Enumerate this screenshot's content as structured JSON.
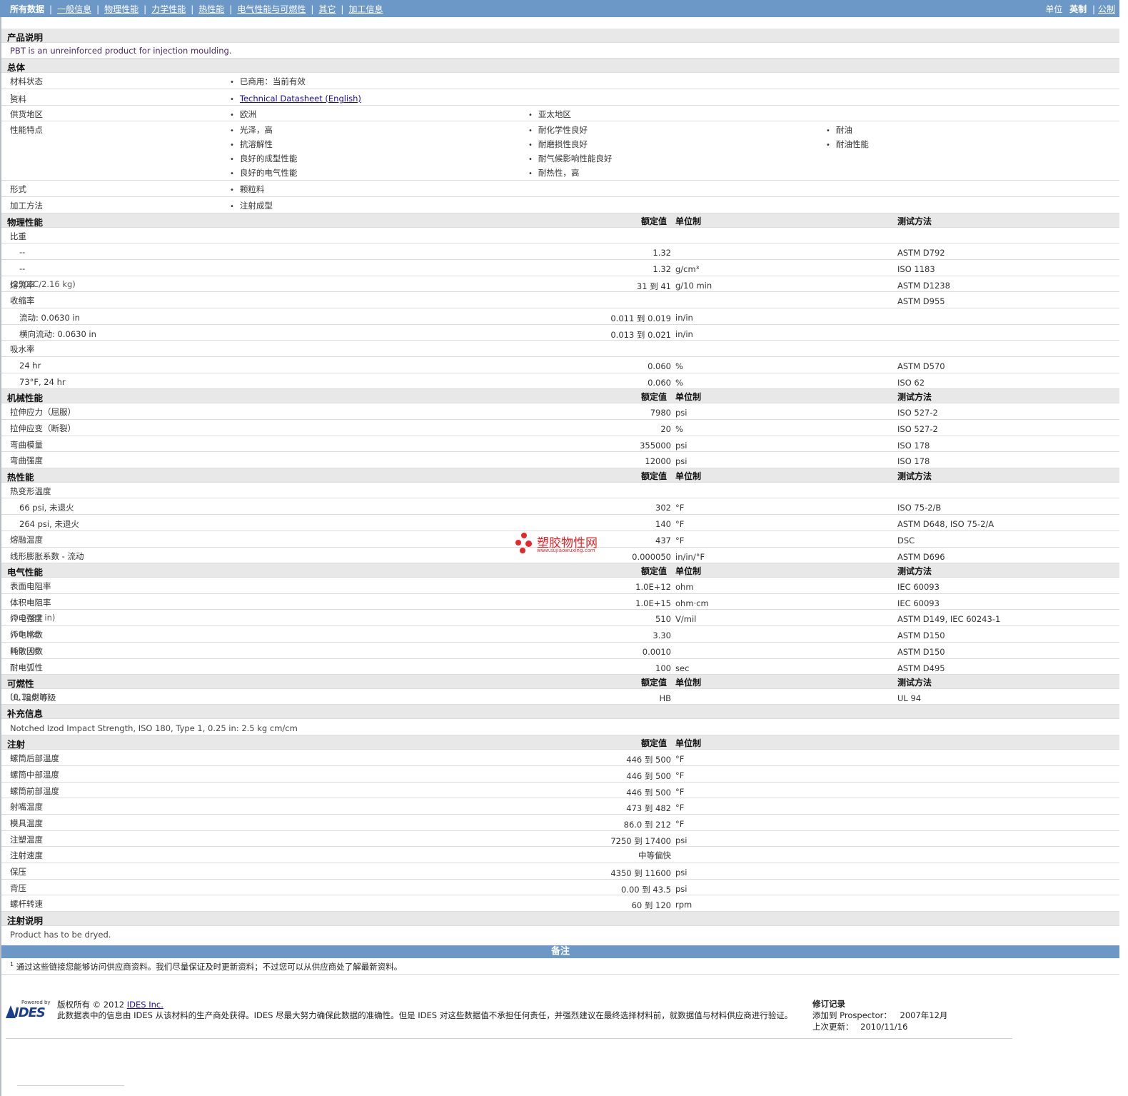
{
  "nav": {
    "items": [
      "所有数据",
      "一般信息",
      "物理性能",
      "力学性能",
      "热性能",
      "电气性能与可燃性",
      "其它",
      "加工信息"
    ],
    "units_label": "单位",
    "unit_imperial": "英制",
    "unit_metric": "公制"
  },
  "headers": {
    "value": "额定值",
    "unit": "单位制",
    "method": "测试方法"
  },
  "product": {
    "title": "产品说明",
    "text": "PBT is an unreinforced product for injection moulding."
  },
  "general": {
    "title": "总体",
    "status_label": "材料状态",
    "status_value": "已商用：当前有效",
    "docs_label": "资料",
    "docs_sup": "1",
    "docs_link": "Technical Datasheet (English)",
    "region_label": "供货地区",
    "regions": [
      "欧洲",
      "亚太地区"
    ],
    "features_label": "性能特点",
    "features_col1": [
      "光泽，高",
      "抗溶解性",
      "良好的成型性能",
      "良好的电气性能"
    ],
    "features_col2": [
      "耐化学性良好",
      "耐磨损性良好",
      "耐气候影响性能良好",
      "耐热性，高"
    ],
    "features_col3": [
      "耐油",
      "耐油性能"
    ],
    "form_label": "形式",
    "form_value": "颗粒料",
    "process_label": "加工方法",
    "process_value": "注射成型"
  },
  "physical": {
    "title": "物理性能",
    "sg_label": "比重",
    "sg1": {
      "label": "--",
      "value": "1.32",
      "unit": "",
      "method": "ASTM D792"
    },
    "sg2": {
      "label": "--",
      "value": "1.32",
      "unit": "g/cm³",
      "method": "ISO 1183"
    },
    "mfr": {
      "label": "熔流率",
      "note": "(250°C/2.16 kg)",
      "value": "31 到 41",
      "unit": "g/10 min",
      "method": "ASTM D1238"
    },
    "shrink_label": "收缩率",
    "shrink_method": "ASTM D955",
    "shrink1": {
      "label": "流动: 0.0630 in",
      "value": "0.011 到 0.019",
      "unit": "in/in"
    },
    "shrink2": {
      "label": "横向流动: 0.0630 in",
      "value": "0.013 到 0.021",
      "unit": "in/in"
    },
    "water_label": "吸水率",
    "water1": {
      "label": "24 hr",
      "value": "0.060",
      "unit": "%",
      "method": "ASTM D570"
    },
    "water2": {
      "label": "73°F, 24 hr",
      "value": "0.060",
      "unit": "%",
      "method": "ISO 62"
    }
  },
  "mechanical": {
    "title": "机械性能",
    "rows": [
      {
        "label": "拉伸应力（屈服）",
        "value": "7980",
        "unit": "psi",
        "method": "ISO 527-2"
      },
      {
        "label": "拉伸应变（断裂）",
        "value": "20",
        "unit": "%",
        "method": "ISO 527-2"
      },
      {
        "label": "弯曲模量",
        "value": "355000",
        "unit": "psi",
        "method": "ISO 178"
      },
      {
        "label": "弯曲强度",
        "value": "12000",
        "unit": "psi",
        "method": "ISO 178"
      }
    ]
  },
  "thermal": {
    "title": "热性能",
    "hdt_label": "热变形温度",
    "hdt1": {
      "label": "66 psi, 未退火",
      "value": "302",
      "unit": "°F",
      "method": "ISO 75-2/B"
    },
    "hdt2": {
      "label": "264 psi, 未退火",
      "value": "140",
      "unit": "°F",
      "method": "ASTM D648, ISO 75-2/A"
    },
    "melt": {
      "label": "熔融温度",
      "value": "437",
      "unit": "°F",
      "method": "DSC"
    },
    "clte": {
      "label": "线形膨胀系数 - 流动",
      "value": "0.000050",
      "unit": "in/in/°F",
      "method": "ASTM D696"
    }
  },
  "electrical": {
    "title": "电气性能",
    "rows": [
      {
        "label": "表面电阻率",
        "note": "",
        "value": "1.0E+12",
        "unit": "ohm",
        "method": "IEC 60093"
      },
      {
        "label": "体积电阻率",
        "note": "",
        "value": "1.0E+15",
        "unit": "ohm·cm",
        "method": "IEC 60093"
      },
      {
        "label": "介电强度",
        "note": "(0.0787 in)",
        "value": "510",
        "unit": "V/mil",
        "method": "ASTM D149, IEC 60243-1"
      },
      {
        "label": "介电常数",
        "note": "(60 Hz)",
        "value": "3.30",
        "unit": "",
        "method": "ASTM D150"
      },
      {
        "label": "耗散因数",
        "note": "(60 Hz)",
        "value": "0.0010",
        "unit": "",
        "method": "ASTM D150"
      },
      {
        "label": "耐电弧性",
        "note": "",
        "value": "100",
        "unit": "sec",
        "method": "ASTM D495"
      }
    ]
  },
  "flammability": {
    "title": "可燃性",
    "row": {
      "label": "UL 阻燃等级",
      "note": "(0.126 in)",
      "value": "HB",
      "unit": "",
      "method": "UL 94"
    }
  },
  "supplement": {
    "title": "补充信息",
    "text": "Notched Izod Impact Strength, ISO 180, Type 1, 0.25 in: 2.5 kg cm/cm"
  },
  "injection": {
    "title": "注射",
    "rows": [
      {
        "label": "螺筒后部温度",
        "value": "446 到 500",
        "unit": "°F"
      },
      {
        "label": "螺筒中部温度",
        "value": "446 到 500",
        "unit": "°F"
      },
      {
        "label": "螺筒前部温度",
        "value": "446 到 500",
        "unit": "°F"
      },
      {
        "label": "射嘴温度",
        "value": "473 到 482",
        "unit": "°F"
      },
      {
        "label": "模具温度",
        "value": "86.0 到 212",
        "unit": "°F"
      },
      {
        "label": "注塑温度",
        "value": "7250 到 17400",
        "unit": "psi"
      },
      {
        "label": "注射速度",
        "value": "中等偏快",
        "unit": ""
      },
      {
        "label": "保压",
        "value": "4350 到 11600",
        "unit": "psi"
      },
      {
        "label": "背压",
        "value": "0.00 到 43.5",
        "unit": "psi"
      },
      {
        "label": "螺杆转速",
        "value": "60 到 120",
        "unit": "rpm"
      }
    ]
  },
  "injection_note": {
    "title": "注射说明",
    "text": "Product has to be dryed."
  },
  "notes": {
    "title": "备注",
    "sup": "1",
    "text": "通过这些链接您能够访问供应商资料。我们尽量保证及时更新资料；不过您可以从供应商处了解最新资料。"
  },
  "footer": {
    "powered": "Powered by",
    "logo": "IDES",
    "copyright": "版权所有 © 2012",
    "company": "IDES Inc.",
    "disclaimer": "此数据表中的信息由 IDES 从该材料的生产商处获得。IDES 尽最大努力确保此数据的准确性。但是 IDES 对这些数据值不承担任何责任，并强烈建议在最终选择材料前，就数据值与材料供应商进行验证。",
    "rev_title": "修订记录",
    "added_label": "添加到 Prospector：",
    "added_value": "2007年12月",
    "updated_label": "上次更新：",
    "updated_value": "2010/11/16"
  },
  "watermark": {
    "title": "塑胶物性网",
    "url": "www.sujiaowuxing.com"
  }
}
